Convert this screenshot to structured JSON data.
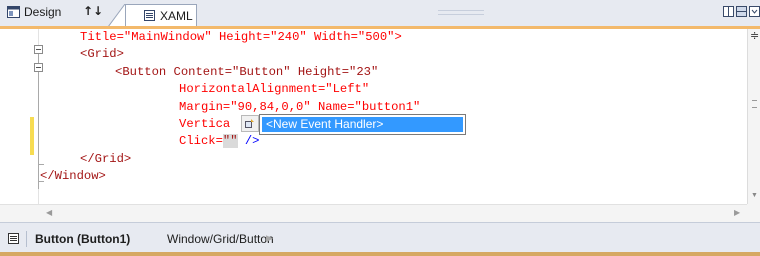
{
  "tabs": {
    "design_label": "Design",
    "swap_label": "↑↓",
    "xaml_label": "XAML"
  },
  "icons": {
    "design": "design-view-icon",
    "xaml": "xaml-view-icon",
    "split_vertical": "split-vertical-icon",
    "split_horizontal": "split-horizontal-icon",
    "collapse": "collapse-pane-icon",
    "smart_tag": "event-handler-icon",
    "status": "document-outline-icon"
  },
  "code": {
    "line1": "Title=\"MainWindow\" Height=\"240\" Width=\"500\">",
    "line2": "<Grid>",
    "line3": "<Button Content=\"Button\" Height=\"23\"",
    "line4": "HorizontalAlignment=\"Left\"",
    "line5": "Margin=\"90,84,0,0\" Name=\"button1\"",
    "line6": "Vertica",
    "line7_attr": "Click=",
    "line7_val": "\"\"",
    "line7_end": " />",
    "line8": "</Grid>",
    "line9": "</Window>"
  },
  "intellisense": {
    "selected_item": "<New Event Handler>"
  },
  "status": {
    "element": "Button (Button1)",
    "path": "Window/Grid/Button"
  },
  "colors": {
    "xaml_string": "#a31515",
    "xaml_attribute": "#ff0000",
    "xaml_tag": "#0000ff",
    "selection": "#3399ff",
    "change_marker": "#f7dc52"
  }
}
